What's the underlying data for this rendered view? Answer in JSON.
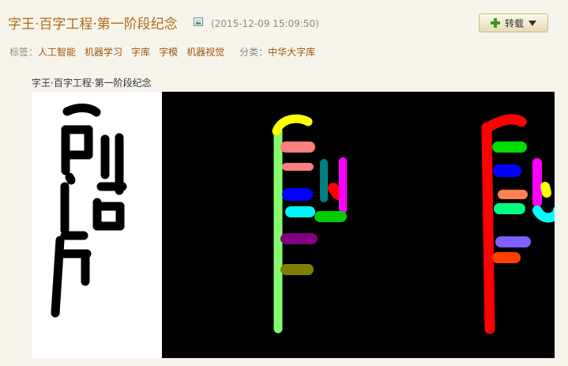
{
  "post": {
    "title": "字王·百字工程·第一阶段纪念",
    "timestamp": "(2015-12-09 15:09:50)",
    "repost_label": "转载",
    "tags_label": "标签：",
    "tags": [
      "人工智能",
      "机器学习",
      "字库",
      "字模",
      "机器视觉"
    ],
    "category_label": "分类：",
    "category": "中华大字库",
    "image_caption": "字王·百字工程·第一阶段纪念"
  },
  "icons": {
    "image": "image-icon",
    "repost": "plus-icon",
    "dropdown": "caret-down-icon"
  },
  "colors": {
    "title": "#b06a17",
    "tag": "#a0540c",
    "background": "#f7f4ec"
  }
}
